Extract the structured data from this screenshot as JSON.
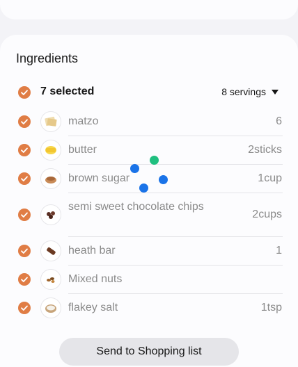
{
  "ingredients_section": {
    "title": "Ingredients",
    "selected_label": "7 selected",
    "servings_label": "8 servings",
    "items": [
      {
        "name": "matzo",
        "qty": "6",
        "icon": "matzo-icon"
      },
      {
        "name": "butter",
        "qty": "2sticks",
        "icon": "butter-icon"
      },
      {
        "name": "brown sugar",
        "qty": "1cup",
        "icon": "brown-sugar-icon"
      },
      {
        "name": "semi sweet chocolate chips",
        "qty": "2cups",
        "icon": "chocolate-chips-icon"
      },
      {
        "name": "heath bar",
        "qty": "1",
        "icon": "heath-bar-icon"
      },
      {
        "name": "Mixed nuts",
        "qty": "",
        "icon": "mixed-nuts-icon"
      },
      {
        "name": "flakey salt",
        "qty": "1tsp",
        "icon": "flakey-salt-icon"
      }
    ]
  },
  "actions": {
    "send_label": "Send to Shopping list"
  },
  "colors": {
    "accent": "#e07d45",
    "loader_blue": "#1a73e8",
    "loader_green": "#1fbf7f"
  }
}
